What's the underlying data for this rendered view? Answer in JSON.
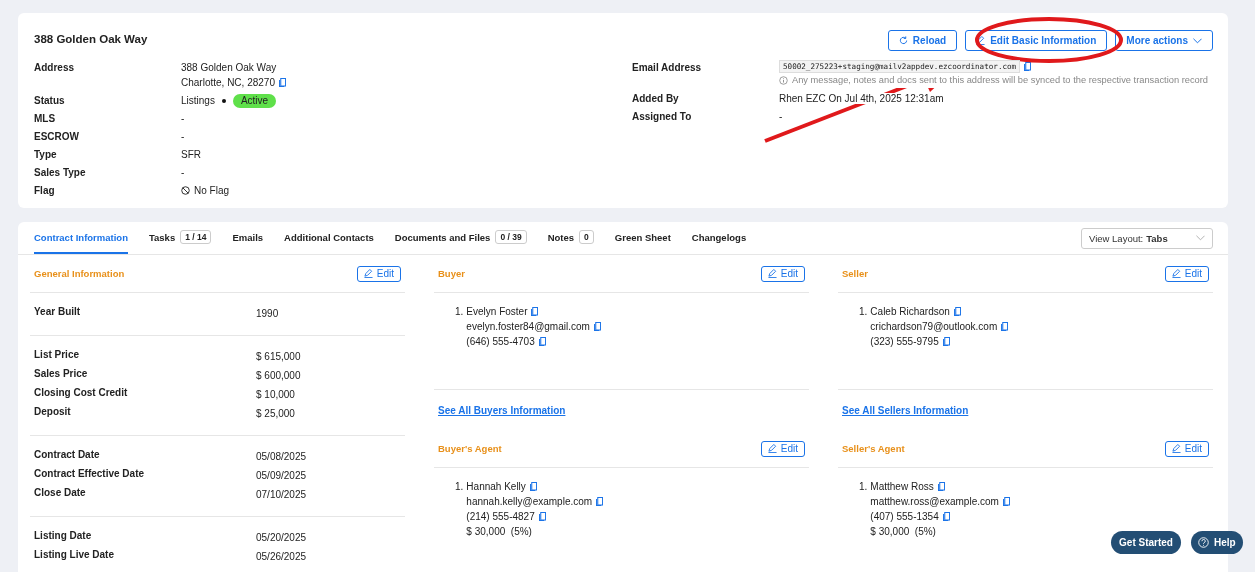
{
  "header": {
    "title": "388 Golden Oak Way",
    "actions": [
      {
        "kind": "reload",
        "label": "Reload"
      },
      {
        "kind": "edit",
        "label": "Edit Basic Information"
      },
      {
        "kind": "menu",
        "label": "More actions"
      }
    ]
  },
  "details_left": [
    {
      "kind": "lines",
      "label": "Address",
      "lines": [
        "388 Golden Oak Way",
        "Charlotte, NC, 28270"
      ]
    },
    {
      "kind": "status",
      "label": "Status",
      "value": "Listings",
      "badge": "Active"
    },
    {
      "kind": "text",
      "label": "MLS",
      "value": "-"
    },
    {
      "kind": "text",
      "label": "ESCROW",
      "value": "-"
    },
    {
      "kind": "text",
      "label": "Type",
      "value": "SFR"
    },
    {
      "kind": "text",
      "label": "Sales Type",
      "value": "-"
    },
    {
      "kind": "flag",
      "label": "Flag",
      "value": "No Flag"
    }
  ],
  "details_right": [
    {
      "kind": "email",
      "label": "Email Address",
      "value": "50002_275223+staging@mailv2appdev.ezcoordinator.com",
      "note": "Any message, notes and docs sent to this address will be synced to the respective transaction record"
    },
    {
      "kind": "text",
      "label": "Added By",
      "value": "Rhen EZC On Jul 4th, 2025 12:31am"
    },
    {
      "kind": "text",
      "label": "Assigned To",
      "value": "-"
    }
  ],
  "tabs": [
    {
      "label": "Contract Information",
      "selected": true
    },
    {
      "label": "Tasks",
      "count": "1 / 14",
      "selected": false
    },
    {
      "label": "Emails",
      "selected": false
    },
    {
      "label": "Additional Contacts",
      "selected": false
    },
    {
      "label": "Documents and Files",
      "count": "0 / 39",
      "selected": false
    },
    {
      "label": "Notes",
      "count": "0",
      "selected": false
    },
    {
      "label": "Green Sheet",
      "selected": false
    },
    {
      "label": "Changelogs",
      "selected": false
    }
  ],
  "view_layout": {
    "label": "View Layout:",
    "value": "Tabs"
  },
  "general": {
    "title": "General Information",
    "edit": "Edit",
    "groups": [
      [
        {
          "label": "Year Built",
          "value": "1990"
        }
      ],
      [
        {
          "label": "List Price",
          "value": "$ 615,000"
        },
        {
          "label": "Sales Price",
          "value": "$ 600,000"
        },
        {
          "label": "Closing Cost Credit",
          "value": "$ 10,000"
        },
        {
          "label": "Deposit",
          "value": "$ 25,000"
        }
      ],
      [
        {
          "label": "Contract Date",
          "value": "05/08/2025"
        },
        {
          "label": "Contract Effective Date",
          "value": "05/09/2025"
        },
        {
          "label": "Close Date",
          "value": "07/10/2025"
        }
      ],
      [
        {
          "label": "Listing Date",
          "value": "05/20/2025"
        },
        {
          "label": "Listing Live Date",
          "value": "05/26/2025"
        }
      ]
    ]
  },
  "party_columns": [
    [
      {
        "title": "Buyer",
        "edit": "Edit",
        "contacts": [
          {
            "number": "1.",
            "name": "Evelyn Foster",
            "email": "evelyn.foster84@gmail.com",
            "phone": "(646) 555-4703"
          }
        ],
        "link": "See All Buyers Information"
      },
      {
        "title": "Buyer's Agent",
        "edit": "Edit",
        "contacts": [
          {
            "number": "1.",
            "name": "Hannah Kelly",
            "email": "hannah.kelly@example.com",
            "phone": "(214) 555-4827",
            "commission": "$ 30,000  (5%)"
          }
        ]
      }
    ],
    [
      {
        "title": "Seller",
        "edit": "Edit",
        "contacts": [
          {
            "number": "1.",
            "name": "Caleb Richardson",
            "email": "crichardson79@outlook.com",
            "phone": "(323) 555-9795"
          }
        ],
        "link": "See All Sellers Information"
      },
      {
        "title": "Seller's Agent",
        "edit": "Edit",
        "contacts": [
          {
            "number": "1.",
            "name": "Matthew Ross",
            "email": "matthew.ross@example.com",
            "phone": "(407) 555-1354",
            "commission": "$ 30,000  (5%)"
          }
        ]
      }
    ]
  ],
  "floating": {
    "get_started": "Get Started",
    "help": "Help"
  }
}
